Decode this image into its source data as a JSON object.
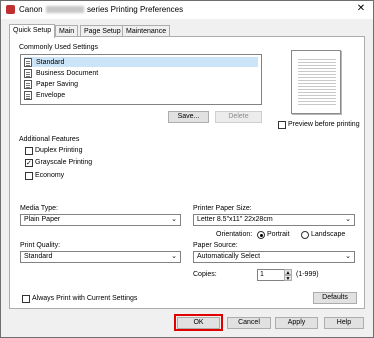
{
  "window": {
    "title_prefix": "Canon",
    "title_suffix": "series Printing Preferences",
    "close_glyph": "✕"
  },
  "tabs": [
    {
      "label": "Quick Setup"
    },
    {
      "label": "Main"
    },
    {
      "label": "Page Setup"
    },
    {
      "label": "Maintenance"
    }
  ],
  "commonly_used": {
    "heading": "Commonly Used Settings",
    "items": [
      {
        "label": "Standard"
      },
      {
        "label": "Business Document"
      },
      {
        "label": "Paper Saving"
      },
      {
        "label": "Envelope"
      }
    ],
    "save_label": "Save...",
    "delete_label": "Delete"
  },
  "preview": {
    "label": "Preview before printing",
    "checked": false
  },
  "additional": {
    "heading": "Additional Features",
    "items": [
      {
        "label": "Duplex Printing",
        "checked": false
      },
      {
        "label": "Grayscale Printing",
        "checked": true
      },
      {
        "label": "Economy",
        "checked": false
      }
    ]
  },
  "media_type": {
    "label": "Media Type:",
    "value": "Plain Paper"
  },
  "printer_paper_size": {
    "label": "Printer Paper Size:",
    "value": "Letter 8.5\"x11\" 22x28cm"
  },
  "orientation": {
    "label": "Orientation:",
    "portrait": "Portrait",
    "landscape": "Landscape",
    "selected": "Portrait"
  },
  "print_quality": {
    "label": "Print Quality:",
    "value": "Standard"
  },
  "paper_source": {
    "label": "Paper Source:",
    "value": "Automatically Select"
  },
  "copies": {
    "label": "Copies:",
    "value": "1",
    "range": "(1-999)"
  },
  "always_print": {
    "label": "Always Print with Current Settings",
    "checked": false
  },
  "defaults_label": "Defaults",
  "footer": {
    "ok": "OK",
    "cancel": "Cancel",
    "apply": "Apply",
    "help": "Help"
  },
  "colors": {
    "highlight": "#e00000",
    "selection": "#cce4f7"
  }
}
